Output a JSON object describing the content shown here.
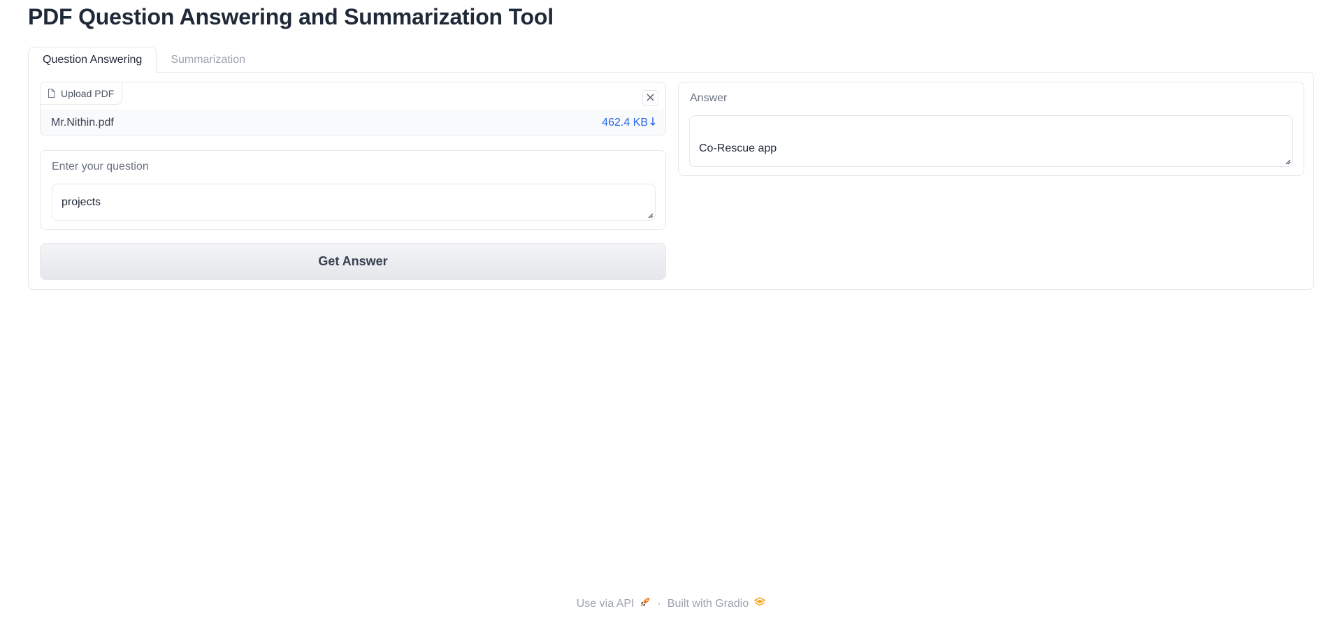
{
  "header": {
    "title": "PDF Question Answering and Summarization Tool"
  },
  "tabs": [
    {
      "label": "Question Answering",
      "active": true
    },
    {
      "label": "Summarization",
      "active": false
    }
  ],
  "file_upload": {
    "label": "Upload PDF",
    "label_icon": "file-icon",
    "file_name": "Mr.Nithin.pdf",
    "file_size": "462.4 KB",
    "download_icon": "download-arrow-icon",
    "clear_icon": "close-icon"
  },
  "question": {
    "label": "Enter your question",
    "value": "projects"
  },
  "submit_button": {
    "label": "Get Answer"
  },
  "answer": {
    "label": "Answer",
    "value": "Co-Rescue app"
  },
  "footer": {
    "api_link": "Use via API",
    "api_icon": "rocket-icon",
    "separator": "·",
    "built_with": "Built with Gradio",
    "gradio_icon": "gradio-logo-icon"
  },
  "colors": {
    "accent_link": "#2563eb",
    "border": "#e5e7eb",
    "muted_text": "#9ca3af",
    "title_text": "#1f2937",
    "rocket": "#f97316",
    "gradio_logo": "#f59e0b"
  }
}
